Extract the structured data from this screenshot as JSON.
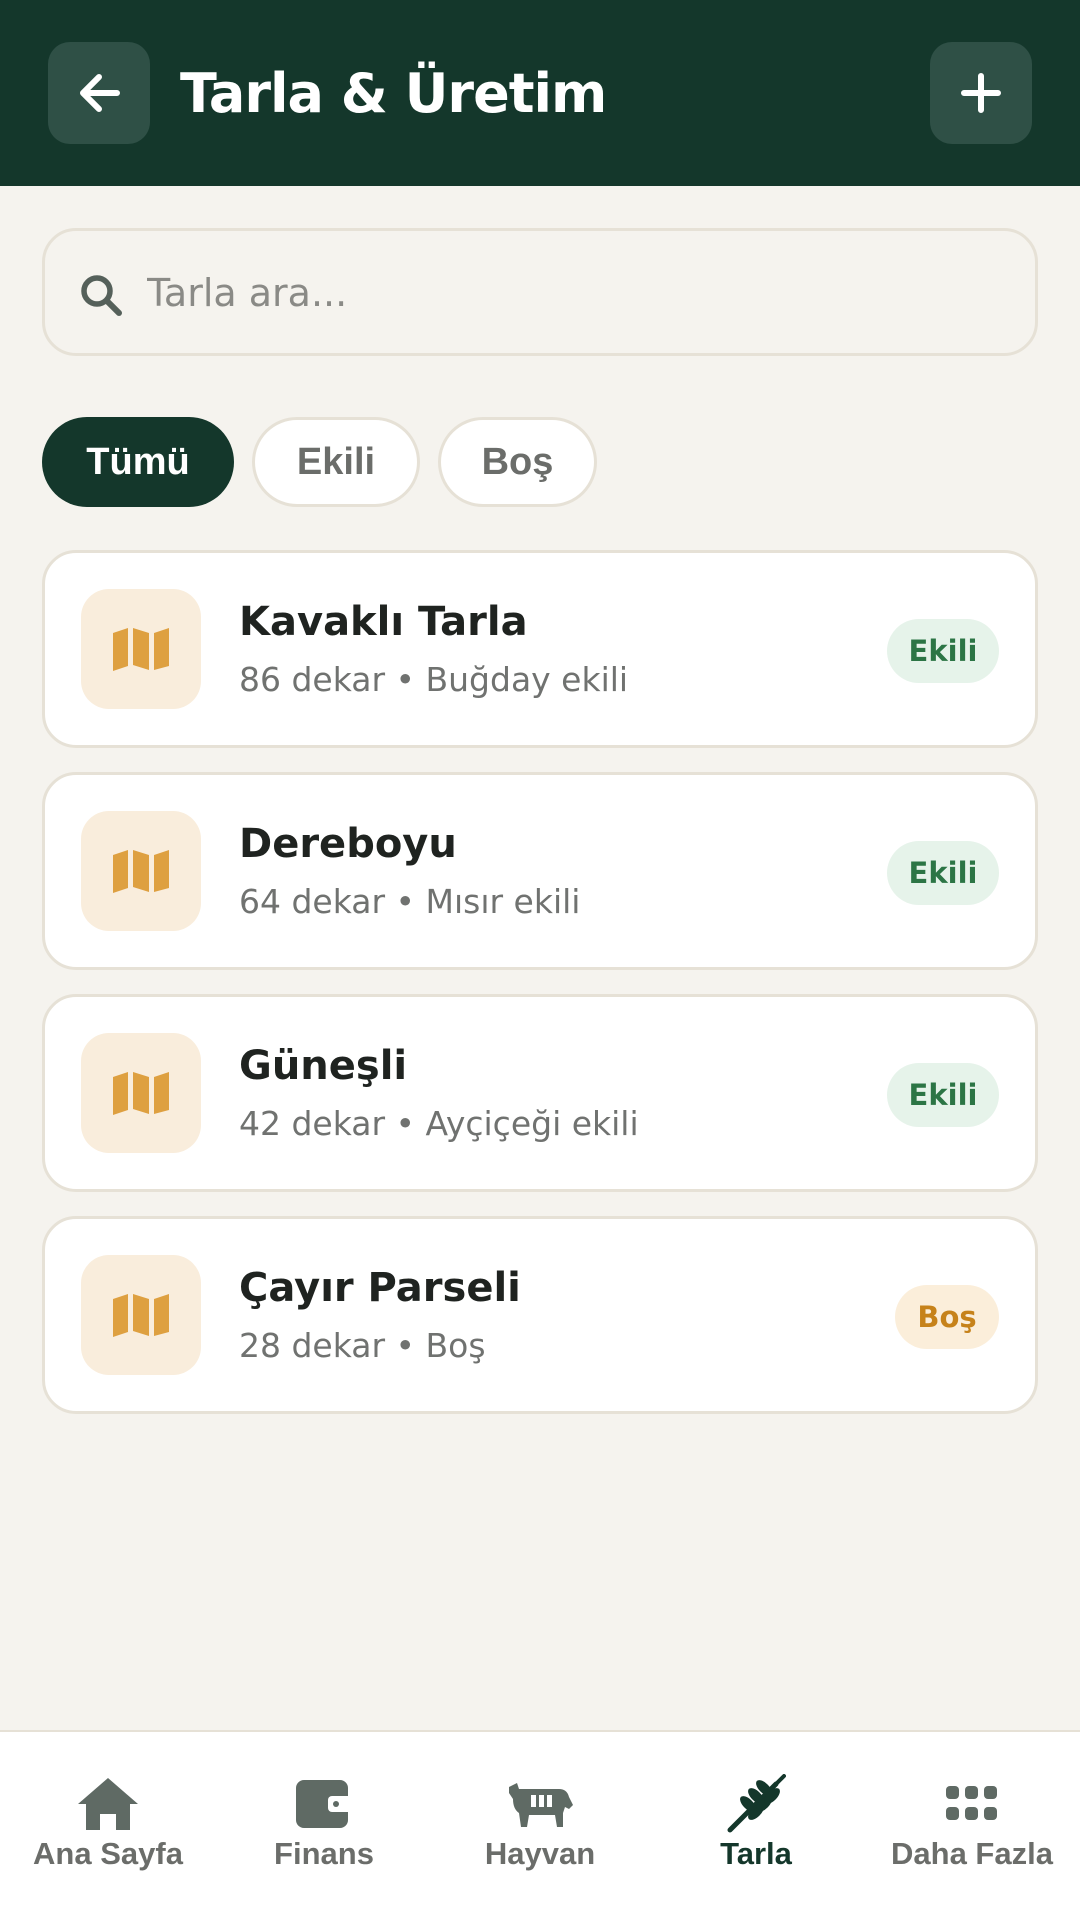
{
  "header": {
    "title": "Tarla & Üretim",
    "back_icon": "arrow-left-icon",
    "add_icon": "plus-icon"
  },
  "search": {
    "placeholder": "Tarla ara...",
    "value": ""
  },
  "filters": [
    {
      "label": "Tümü",
      "active": true
    },
    {
      "label": "Ekili",
      "active": false
    },
    {
      "label": "Boş",
      "active": false
    }
  ],
  "fields": [
    {
      "name": "Kavaklı Tarla",
      "subtitle": "86 dekar • Buğday ekili",
      "status": "Ekili"
    },
    {
      "name": "Dereboyu",
      "subtitle": "64 dekar • Mısır ekili",
      "status": "Ekili"
    },
    {
      "name": "Güneşli",
      "subtitle": "42 dekar • Ayçiçeği ekili",
      "status": "Ekili"
    },
    {
      "name": "Çayır Parseli",
      "subtitle": "28 dekar • Boş",
      "status": "Boş"
    }
  ],
  "nav": [
    {
      "label": "Ana Sayfa",
      "icon": "home-icon",
      "active": false
    },
    {
      "label": "Finans",
      "icon": "wallet-icon",
      "active": false
    },
    {
      "label": "Hayvan",
      "icon": "cow-icon",
      "active": false
    },
    {
      "label": "Tarla",
      "icon": "wheat-icon",
      "active": true
    },
    {
      "label": "Daha Fazla",
      "icon": "grid-dots-icon",
      "active": false
    }
  ],
  "colors": {
    "primary": "#14372b",
    "background": "#f5f3ee",
    "accent_gold": "#dea040",
    "ekili_text": "#2c7545",
    "bos_text": "#c6821a"
  }
}
